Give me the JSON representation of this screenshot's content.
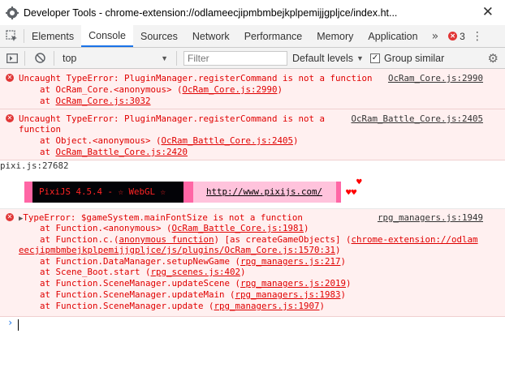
{
  "window": {
    "title": "Developer Tools - chrome-extension://odlameecjipmbmbejkplpemijjgpljce/index.ht...",
    "close_glyph": "✕"
  },
  "tabs": [
    {
      "label": "Elements",
      "active": false
    },
    {
      "label": "Console",
      "active": true
    },
    {
      "label": "Sources",
      "active": false
    },
    {
      "label": "Network",
      "active": false
    },
    {
      "label": "Performance",
      "active": false
    },
    {
      "label": "Memory",
      "active": false
    },
    {
      "label": "Application",
      "active": false
    }
  ],
  "tabbar": {
    "more_glyph": "»",
    "error_count": "3",
    "kebab_glyph": "⋮"
  },
  "toolbar": {
    "context": "top",
    "filter_placeholder": "Filter",
    "levels_label": "Default levels",
    "group_similar_label": "Group similar",
    "group_similar_checked": true
  },
  "messages": {
    "m1": {
      "text": "Uncaught TypeError: PluginManager.registerCommand is not a function",
      "source": "OcRam_Core.js:2990",
      "stack1_pre": "    at OcRam_Core.<anonymous> (",
      "stack1_link": "OcRam_Core.js:2990",
      "stack1_post": ")",
      "stack2_pre": "    at ",
      "stack2_link": "OcRam_Core.js:3032"
    },
    "m2": {
      "text1": "Uncaught TypeError: PluginManager.registerCommand is not a",
      "text2": "function",
      "source": "OcRam_Battle_Core.js:2405",
      "stack1_pre": "    at Object.<anonymous> (",
      "stack1_link": "OcRam_Battle_Core.js:2405",
      "stack1_post": ")",
      "stack2_pre": "    at ",
      "stack2_link": "OcRam_Battle_Core.js:2420"
    },
    "m3": {
      "source": "pixi.js:27682",
      "banner_text": "PixiJS 4.5.4 - ☆ WebGL ☆",
      "banner_url": "http://www.pixijs.com/",
      "hearts_top": "♥",
      "hearts_bottom": "♥♥"
    },
    "m4": {
      "triangle": "▶",
      "text": "TypeError: $gameSystem.mainFontSize is not a function",
      "source": "rpg_managers.js:1949",
      "lines": [
        {
          "pre": "    at Function.<anonymous> (",
          "link": "OcRam_Battle_Core.js:1981",
          "post": ")"
        },
        {
          "pre": "    at Function.c.(",
          "link": "anonymous function",
          "post": ") [as createGameObjects] ("
        },
        {
          "pre": "",
          "link": "eecjipmbmbejkplpemijjgpljce/js/plugins/OcRam_Core.js:1570:31",
          "post": ")"
        },
        {
          "pre": "    at Function.DataManager.setupNewGame (",
          "link": "rpg_managers.js:217",
          "post": ")"
        },
        {
          "pre": "    at Scene_Boot.start (",
          "link": "rpg_scenes.js:402",
          "post": ")"
        },
        {
          "pre": "    at Function.SceneManager.updateScene (",
          "link": "rpg_managers.js:2019",
          "post": ")"
        },
        {
          "pre": "    at Function.SceneManager.updateMain (",
          "link": "rpg_managers.js:1983",
          "post": ")"
        },
        {
          "pre": "    at Function.SceneManager.update (",
          "link": "rpg_managers.js:1907",
          "post": ")"
        }
      ],
      "ext_link": "chrome-extension://odlam"
    }
  },
  "prompt": {
    "glyph": "›"
  },
  "colors": {
    "error_bg": "#fff0f0",
    "error_text": "#e00000",
    "accent": "#1a73e8",
    "banner_pink": "#ff66a5",
    "banner_dark": "#030307"
  }
}
